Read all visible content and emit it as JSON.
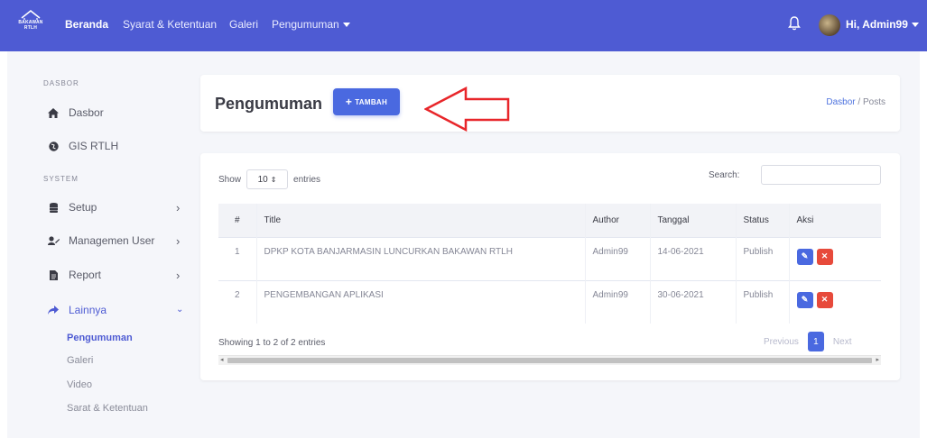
{
  "app": {
    "brand_line1": "BAKAWAN",
    "brand_line2": "RTLH"
  },
  "nav": {
    "items": [
      {
        "label": "Beranda"
      },
      {
        "label": "Syarat & Ketentuan"
      },
      {
        "label": "Galeri"
      },
      {
        "label": "Pengumuman"
      }
    ],
    "user_greeting": "Hi, Admin99"
  },
  "sidebar": {
    "heading_dasbor": "DASBOR",
    "heading_system": "SYSTEM",
    "items": [
      {
        "label": "Dasbor",
        "icon": "home-icon"
      },
      {
        "label": "GIS RTLH",
        "icon": "globe-icon"
      },
      {
        "label": "Setup",
        "icon": "database-icon"
      },
      {
        "label": "Managemen User",
        "icon": "users-icon"
      },
      {
        "label": "Report",
        "icon": "file-icon"
      },
      {
        "label": "Lainnya",
        "icon": "share-icon"
      }
    ],
    "subitems": [
      {
        "label": "Pengumuman"
      },
      {
        "label": "Galeri"
      },
      {
        "label": "Video"
      },
      {
        "label": "Sarat & Ketentuan"
      }
    ]
  },
  "header": {
    "title": "Pengumuman",
    "add_button": "TAMBAH",
    "breadcrumb_link": "Dasbor",
    "breadcrumb_sep": "/",
    "breadcrumb_current": "Posts"
  },
  "table": {
    "show_label": "Show",
    "entries_value": "10",
    "entries_label": "entries",
    "search_label": "Search:",
    "search_value": "",
    "columns": [
      "#",
      "Title",
      "Author",
      "Tanggal",
      "Status",
      "Aksi"
    ],
    "rows": [
      {
        "no": "1",
        "title": "DPKP KOTA BANJARMASIN LUNCURKAN BAKAWAN RTLH",
        "author": "Admin99",
        "date": "14-06-2021",
        "status": "Publish"
      },
      {
        "no": "2",
        "title": "PENGEMBANGAN APLIKASI",
        "author": "Admin99",
        "date": "30-06-2021",
        "status": "Publish"
      }
    ],
    "info": "Showing 1 to 2 of 2 entries",
    "prev": "Previous",
    "page": "1",
    "next": "Next"
  },
  "colors": {
    "navbar": "#4e5bd3",
    "primary": "#4a69e0",
    "danger": "#e74a3b",
    "annotation_arrow": "#e8262a"
  }
}
